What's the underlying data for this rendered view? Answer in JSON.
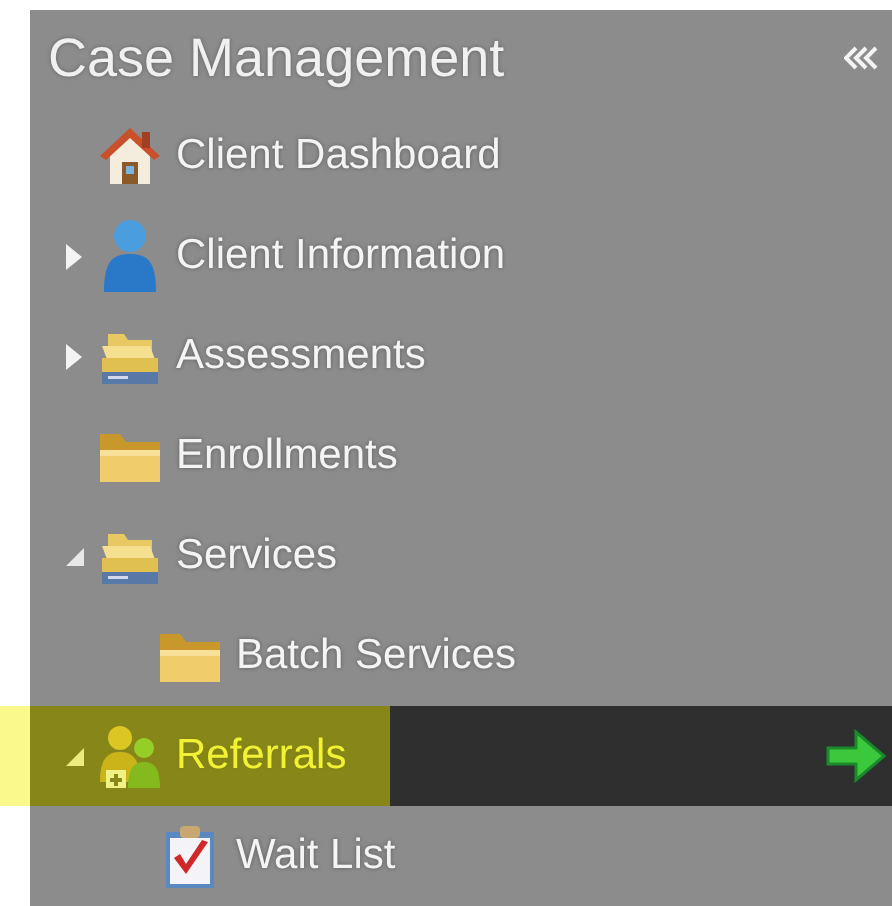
{
  "sidebar": {
    "title": "Case Management",
    "items": [
      {
        "label": "Client Dashboard",
        "kind": "home",
        "selected": false
      },
      {
        "label": "Client Information",
        "kind": "person",
        "selected": false,
        "expanded": false
      },
      {
        "label": "Assessments",
        "kind": "folders",
        "selected": false,
        "expanded": false
      },
      {
        "label": "Enrollments",
        "kind": "folder",
        "selected": false
      },
      {
        "label": "Services",
        "kind": "folders",
        "selected": false,
        "expanded": true,
        "children": [
          {
            "label": "Batch Services",
            "kind": "folder",
            "selected": false
          }
        ]
      },
      {
        "label": "Referrals",
        "kind": "people",
        "selected": true,
        "expanded": true,
        "children": [
          {
            "label": "Wait List",
            "kind": "checklist",
            "selected": false
          }
        ]
      }
    ]
  }
}
